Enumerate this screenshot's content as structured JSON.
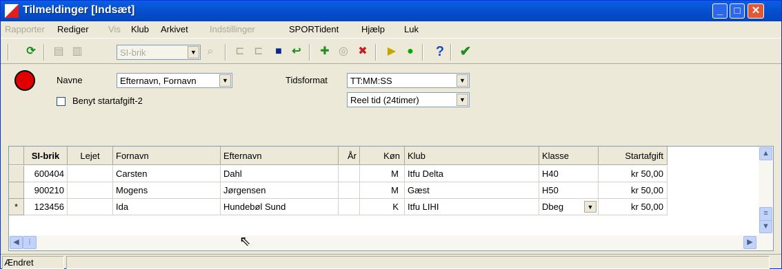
{
  "window": {
    "title": "Tilmeldinger [Indsæt]"
  },
  "menu": [
    {
      "label": "Rapporter",
      "enabled": false
    },
    {
      "label": "Rediger",
      "enabled": true
    },
    {
      "label": "Vis",
      "enabled": false
    },
    {
      "label": "Klub",
      "enabled": true
    },
    {
      "label": "Arkivet",
      "enabled": true
    },
    {
      "label": "Indstillinger",
      "enabled": false
    },
    {
      "label": "SPORTident",
      "enabled": true
    },
    {
      "label": "Hjælp",
      "enabled": true
    },
    {
      "label": "Luk",
      "enabled": true
    }
  ],
  "toolbar": {
    "chip_combo": "SI-brik",
    "icons": [
      "refresh-icon",
      "copy-icon",
      "paste-icon",
      "zoom-icon",
      "align-icon",
      "align2-icon",
      "save-icon",
      "undo-icon",
      "add-icon",
      "circle-icon",
      "delete-icon",
      "gate-icon",
      "go-icon",
      "help-icon",
      "check-icon"
    ]
  },
  "options": {
    "navne_label": "Navne",
    "navne_value": "Efternavn, Fornavn",
    "tidsformat_label": "Tidsformat",
    "tidsformat_value": "TT:MM:SS",
    "tidstype_value": "Reel tid (24timer)",
    "startafgift2_label": "Benyt startafgift-2",
    "startafgift2_checked": false,
    "status_color": "#E00000"
  },
  "table": {
    "columns": [
      "SI-brik",
      "Lejet",
      "Fornavn",
      "Efternavn",
      "År",
      "Køn",
      "Klub",
      "Klasse",
      "Startafgift"
    ],
    "rows": [
      {
        "marker": "",
        "cells": [
          "600404",
          "",
          "Carsten",
          "Dahl",
          "",
          "M",
          "Itfu Delta",
          "H40",
          "kr 50,00"
        ]
      },
      {
        "marker": "",
        "cells": [
          "900210",
          "",
          "Mogens",
          "Jørgensen",
          "",
          "M",
          "Gæst",
          "H50",
          "kr 50,00"
        ]
      },
      {
        "marker": "*",
        "cells": [
          "123456",
          "",
          "Ida",
          "Hundebøl Sund",
          "",
          "K",
          "Itfu LIHI",
          "Dbeg",
          "kr 50,00"
        ]
      }
    ]
  },
  "status": {
    "text": "Ændret"
  }
}
